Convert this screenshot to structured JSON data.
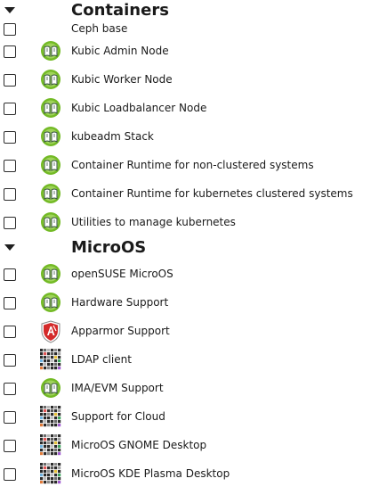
{
  "groups": [
    {
      "title": "Containers",
      "expanded": true,
      "patterns": [
        {
          "label": "Ceph base",
          "icon": "none",
          "checked": false
        },
        {
          "label": "Kubic Admin Node",
          "icon": "opensuse-pattern-icon",
          "checked": false
        },
        {
          "label": "Kubic Worker Node",
          "icon": "opensuse-pattern-icon",
          "checked": false
        },
        {
          "label": "Kubic Loadbalancer Node",
          "icon": "opensuse-pattern-icon",
          "checked": false
        },
        {
          "label": "kubeadm Stack",
          "icon": "opensuse-pattern-icon",
          "checked": false
        },
        {
          "label": "Container Runtime for non-clustered systems",
          "icon": "opensuse-pattern-icon",
          "checked": false
        },
        {
          "label": "Container Runtime for kubernetes clustered systems",
          "icon": "opensuse-pattern-icon",
          "checked": false
        },
        {
          "label": "Utilities to manage kubernetes",
          "icon": "opensuse-pattern-icon",
          "checked": false
        }
      ]
    },
    {
      "title": "MicroOS",
      "expanded": true,
      "patterns": [
        {
          "label": "openSUSE MicroOS",
          "icon": "opensuse-pattern-icon",
          "checked": false
        },
        {
          "label": "Hardware Support",
          "icon": "opensuse-pattern-icon",
          "checked": false
        },
        {
          "label": "Apparmor Support",
          "icon": "apparmor-shield-icon",
          "checked": false
        },
        {
          "label": "LDAP client",
          "icon": "color-grid-icon",
          "checked": false
        },
        {
          "label": "IMA/EVM Support",
          "icon": "opensuse-pattern-icon",
          "checked": false
        },
        {
          "label": "Support for Cloud",
          "icon": "color-grid-icon",
          "checked": false
        },
        {
          "label": "MicroOS GNOME Desktop",
          "icon": "color-grid-icon",
          "checked": false
        },
        {
          "label": "MicroOS KDE Plasma Desktop",
          "icon": "color-grid-icon",
          "checked": false
        }
      ]
    }
  ],
  "colors": {
    "opensuse_green": "#73ba25",
    "opensuse_dark": "#35513f",
    "apparmor_red": "#d42a2a",
    "text": "#1a1a1a"
  }
}
